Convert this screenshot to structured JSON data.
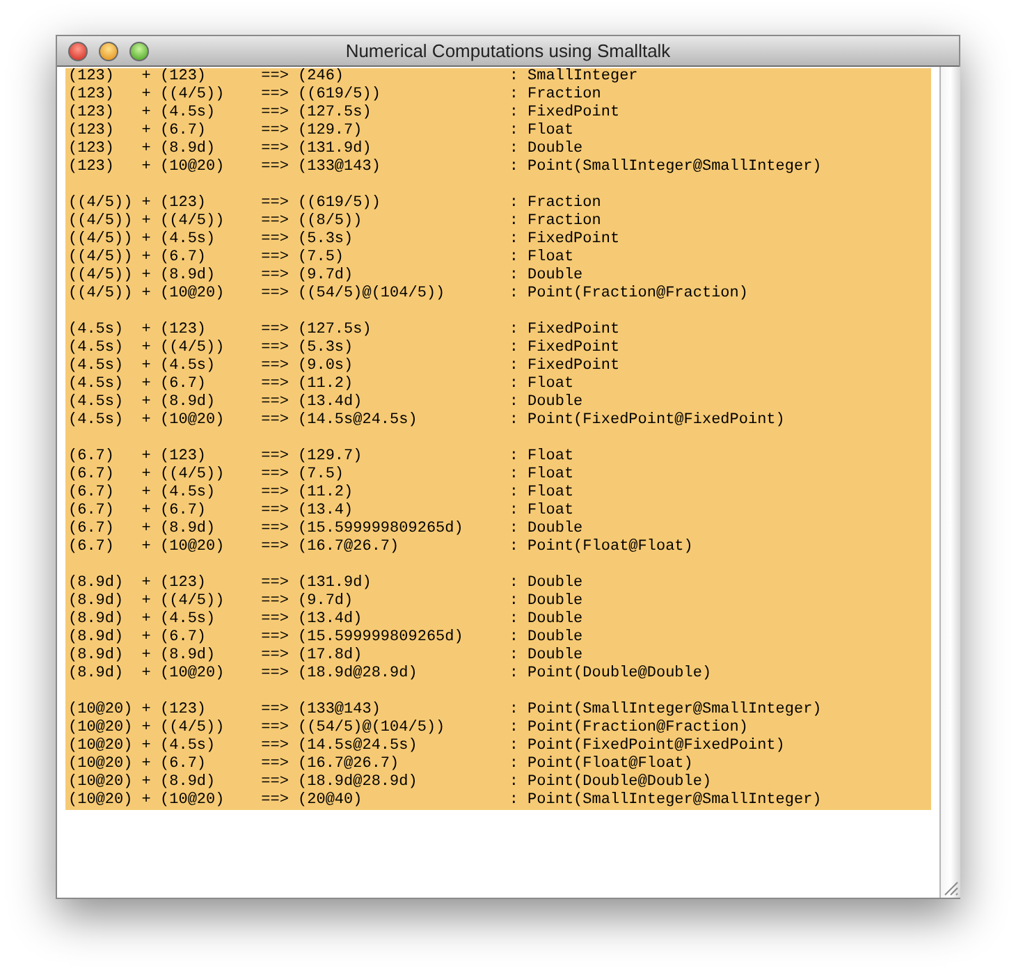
{
  "window": {
    "title": "Numerical Computations using Smalltalk"
  },
  "transcript": {
    "groups": [
      [
        "(123)   + (123)      ==> (246)                  : SmallInteger",
        "(123)   + ((4/5))    ==> ((619/5))              : Fraction",
        "(123)   + (4.5s)     ==> (127.5s)               : FixedPoint",
        "(123)   + (6.7)      ==> (129.7)                : Float",
        "(123)   + (8.9d)     ==> (131.9d)               : Double",
        "(123)   + (10@20)    ==> (133@143)              : Point(SmallInteger@SmallInteger)"
      ],
      [
        "((4/5)) + (123)      ==> ((619/5))              : Fraction",
        "((4/5)) + ((4/5))    ==> ((8/5))                : Fraction",
        "((4/5)) + (4.5s)     ==> (5.3s)                 : FixedPoint",
        "((4/5)) + (6.7)      ==> (7.5)                  : Float",
        "((4/5)) + (8.9d)     ==> (9.7d)                 : Double",
        "((4/5)) + (10@20)    ==> ((54/5)@(104/5))       : Point(Fraction@Fraction)"
      ],
      [
        "(4.5s)  + (123)      ==> (127.5s)               : FixedPoint",
        "(4.5s)  + ((4/5))    ==> (5.3s)                 : FixedPoint",
        "(4.5s)  + (4.5s)     ==> (9.0s)                 : FixedPoint",
        "(4.5s)  + (6.7)      ==> (11.2)                 : Float",
        "(4.5s)  + (8.9d)     ==> (13.4d)                : Double",
        "(4.5s)  + (10@20)    ==> (14.5s@24.5s)          : Point(FixedPoint@FixedPoint)"
      ],
      [
        "(6.7)   + (123)      ==> (129.7)                : Float",
        "(6.7)   + ((4/5))    ==> (7.5)                  : Float",
        "(6.7)   + (4.5s)     ==> (11.2)                 : Float",
        "(6.7)   + (6.7)      ==> (13.4)                 : Float",
        "(6.7)   + (8.9d)     ==> (15.599999809265d)     : Double",
        "(6.7)   + (10@20)    ==> (16.7@26.7)            : Point(Float@Float)"
      ],
      [
        "(8.9d)  + (123)      ==> (131.9d)               : Double",
        "(8.9d)  + ((4/5))    ==> (9.7d)                 : Double",
        "(8.9d)  + (4.5s)     ==> (13.4d)                : Double",
        "(8.9d)  + (6.7)      ==> (15.599999809265d)     : Double",
        "(8.9d)  + (8.9d)     ==> (17.8d)                : Double",
        "(8.9d)  + (10@20)    ==> (18.9d@28.9d)          : Point(Double@Double)"
      ],
      [
        "(10@20) + (123)      ==> (133@143)              : Point(SmallInteger@SmallInteger)",
        "(10@20) + ((4/5))    ==> ((54/5)@(104/5))       : Point(Fraction@Fraction)",
        "(10@20) + (4.5s)     ==> (14.5s@24.5s)          : Point(FixedPoint@FixedPoint)",
        "(10@20) + (6.7)      ==> (16.7@26.7)            : Point(Float@Float)",
        "(10@20) + (8.9d)     ==> (18.9d@28.9d)          : Point(Double@Double)",
        "(10@20) + (10@20)    ==> (20@40)                : Point(SmallInteger@SmallInteger)"
      ]
    ]
  }
}
